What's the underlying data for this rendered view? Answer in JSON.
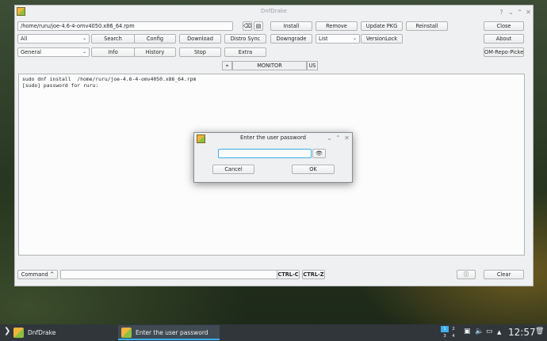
{
  "window": {
    "title": "DnfDrake"
  },
  "toolbar": {
    "package_path": "/home/ruru/joe-4.6-4-omv4050.x86_64.rpm",
    "filter_all": "All",
    "filter_general": "General",
    "buttons": {
      "install": "Install",
      "remove": "Remove",
      "update_pkg": "Update PKG",
      "reinstall": "Reinstall",
      "close": "Close",
      "search": "Search",
      "config": "Config",
      "download": "Download",
      "distro_sync": "Distro Sync",
      "downgrade": "Downgrade",
      "list": "List",
      "versionlock": "VersionLock",
      "about": "About",
      "info": "Info",
      "history": "History",
      "stop": "Stop",
      "extra": "Extra",
      "om_repo_picker": "OM-Repo-Picker"
    }
  },
  "tabs": {
    "monitor": "MONITOR",
    "us": "US"
  },
  "terminal": {
    "lines": [
      "sudo dnf install  /home/ruru/joe-4.6-4-omv4050.x86_64.rpm",
      "[sudo] password for ruru:"
    ]
  },
  "bottom": {
    "command_label": "Command ^",
    "command_value": "",
    "ctrl_c": "CTRL-C",
    "ctrl_z": "CTRL-Z",
    "clear": "Clear"
  },
  "dialog": {
    "title": "Enter the user password",
    "password_value": "",
    "cancel": "Cancel",
    "ok": "OK"
  },
  "taskbar": {
    "tasks": [
      "DnfDrake",
      "Enter the user password"
    ],
    "pager": [
      "1",
      "2",
      "3",
      "4"
    ],
    "clock": "12:57"
  }
}
